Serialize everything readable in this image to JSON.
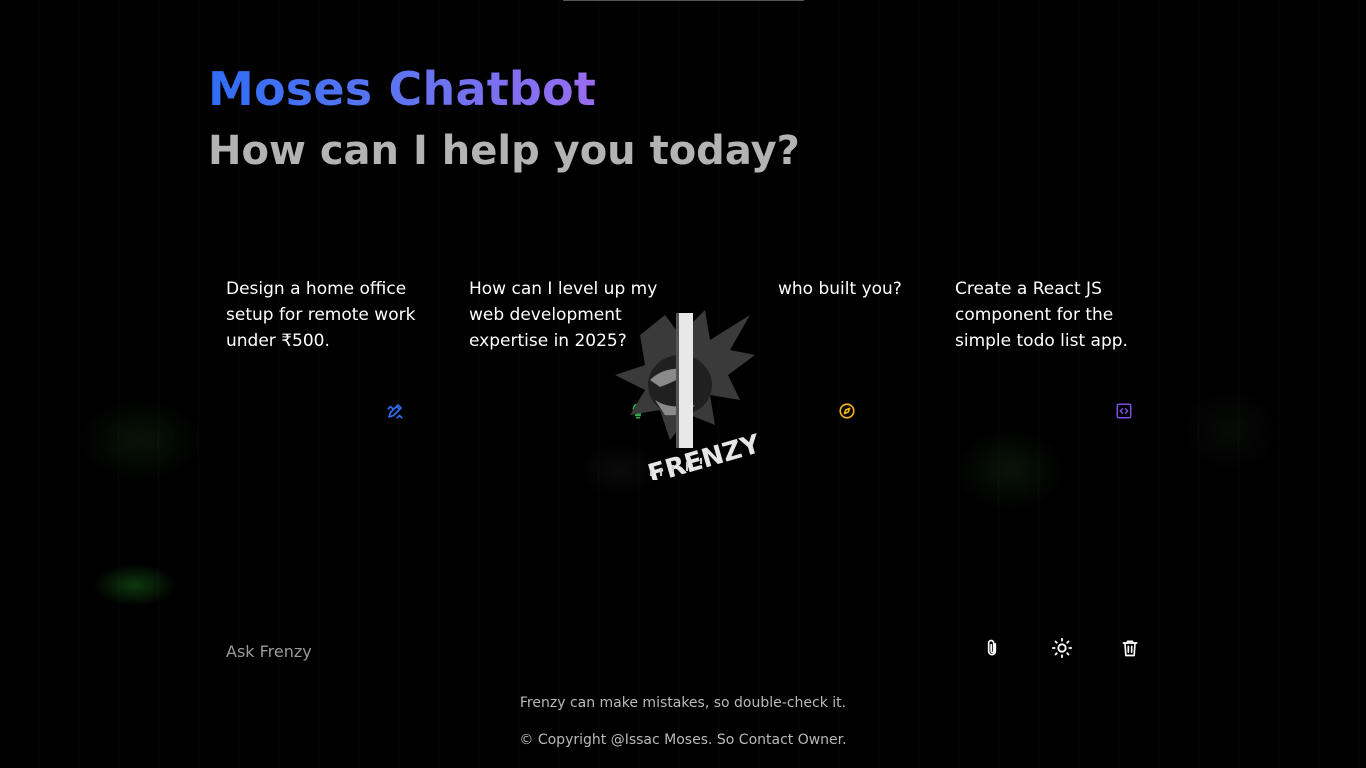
{
  "header": {
    "title": "Moses Chatbot",
    "subtitle": "How can I help you today?"
  },
  "suggestions": [
    {
      "text": "Design a home office setup for remote work under ₹500.",
      "icon": "pencil-ruler-icon",
      "icon_color": "#2f6df6"
    },
    {
      "text": "How can I level up my web development expertise in 2025?",
      "icon": "lightbulb-icon",
      "icon_color": "#2fb24a"
    },
    {
      "text": "who built you?",
      "icon": "compass-icon",
      "icon_color": "#f1b21a"
    },
    {
      "text": "Create a React JS component for the simple todo list app.",
      "icon": "code-icon",
      "icon_color": "#7b4fe0"
    }
  ],
  "logo": {
    "text": "FRENZY",
    "icon": "frenzy-logo-icon"
  },
  "prompt": {
    "placeholder": "Ask Frenzy",
    "value": ""
  },
  "actions": {
    "attach_icon": "paperclip-icon",
    "theme_icon": "sun-icon",
    "delete_icon": "trash-icon"
  },
  "footer": {
    "disclaimer": "Frenzy can make mistakes, so double-check it.",
    "copyright": "© Copyright @Issac Moses. So Contact Owner."
  }
}
